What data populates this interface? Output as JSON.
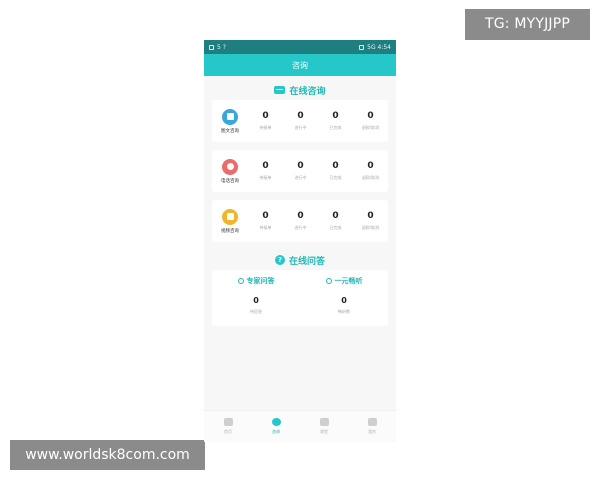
{
  "watermarks": {
    "top_right": "TG: MYYJJPP",
    "bottom_left": "www.worldsk8com.com"
  },
  "status_bar": {
    "left": "5 ?",
    "right": "5G 4:54"
  },
  "header": {
    "title": "咨询"
  },
  "online_consult": {
    "title": "在线咨询",
    "services": [
      {
        "name": "图文咨询",
        "icon": "chat-doc-icon",
        "color": "#3aa6e0",
        "stats": [
          {
            "value": "0",
            "label": "待接单"
          },
          {
            "value": "0",
            "label": "进行中"
          },
          {
            "value": "0",
            "label": "已完成"
          },
          {
            "value": "0",
            "label": "退款/取消"
          }
        ]
      },
      {
        "name": "电话咨询",
        "icon": "phone-icon",
        "color": "#ec6b6b",
        "stats": [
          {
            "value": "0",
            "label": "待接单"
          },
          {
            "value": "0",
            "label": "进行中"
          },
          {
            "value": "0",
            "label": "已完成"
          },
          {
            "value": "0",
            "label": "退款/取消"
          }
        ]
      },
      {
        "name": "视频咨询",
        "icon": "video-icon",
        "color": "#f1b52c",
        "stats": [
          {
            "value": "0",
            "label": "待接单"
          },
          {
            "value": "0",
            "label": "进行中"
          },
          {
            "value": "0",
            "label": "已完成"
          },
          {
            "value": "0",
            "label": "退款/取消"
          }
        ]
      }
    ]
  },
  "online_qa": {
    "title": "在线问答",
    "items": [
      {
        "title": "专家问答",
        "value": "0",
        "label": "待回答"
      },
      {
        "title": "一元畅听",
        "value": "0",
        "label": "畅听数"
      }
    ]
  },
  "tabbar": {
    "items": [
      {
        "label": "首页",
        "active": false
      },
      {
        "label": "咨询",
        "active": true
      },
      {
        "label": "课堂",
        "active": false
      },
      {
        "label": "我的",
        "active": false
      }
    ]
  },
  "colors": {
    "accent": "#25c7c9",
    "status_bar": "#1f7f80"
  }
}
